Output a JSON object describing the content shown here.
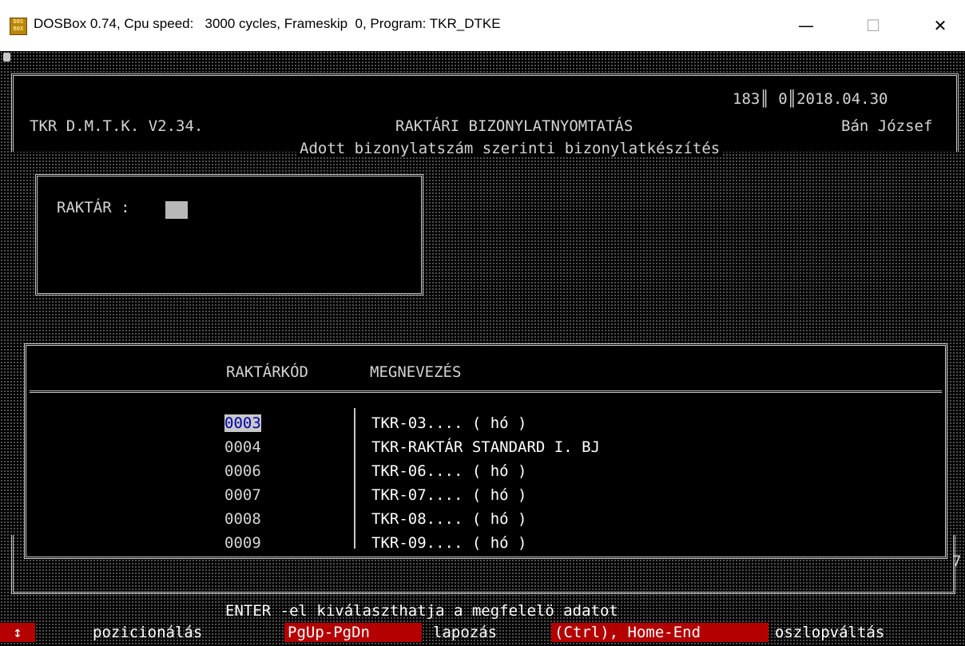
{
  "window": {
    "title": "DOSBox 0.74, Cpu speed:   3000 cycles, Frameskip  0, Program: TKR_DTKE",
    "icon_text": "DOS BOX",
    "minimize": "—",
    "maximize": "☐",
    "close": "✕"
  },
  "header": {
    "counter": "183║ 0║2018.04.30",
    "product": "TKR D.M.T.K. V2.34.",
    "title": "RAKTÁRI BIZONYLATNYOMTATÁS",
    "user": "Bán József",
    "subtitle": "Adott bizonylatszám szerinti bizonylatkészítés"
  },
  "prompt": {
    "label": "RAKTÁR :"
  },
  "list": {
    "columns": [
      "RAKTÁRKÓD",
      "MEGNEVEZÉS"
    ],
    "rows": [
      {
        "code": "0003",
        "name": "TKR-03.... ( hó )"
      },
      {
        "code": "0004",
        "name": "TKR-RAKTÁR STANDARD I. BJ"
      },
      {
        "code": "0006",
        "name": "TKR-06.... ( hó )"
      },
      {
        "code": "0007",
        "name": "TKR-07.... ( hó )"
      },
      {
        "code": "0008",
        "name": "TKR-08.... ( hó )"
      },
      {
        "code": "0009",
        "name": "TKR-09.... ( hó )"
      }
    ],
    "selected_index": 0
  },
  "frame_digit": "7",
  "status": {
    "hint": "ENTER -el kiválaszthatja a megfelelö adatot",
    "keys": [
      {
        "key": "↕",
        "desc": "pozicionálás"
      },
      {
        "key": "PgUp-PgDn",
        "desc": "lapozás"
      },
      {
        "key": "(Ctrl), Home-End",
        "desc": "oszlopváltás"
      }
    ]
  },
  "colors": {
    "key_bg": "#b40000",
    "selection_bg": "#c8c8c8",
    "selection_fg": "#0000aa"
  }
}
